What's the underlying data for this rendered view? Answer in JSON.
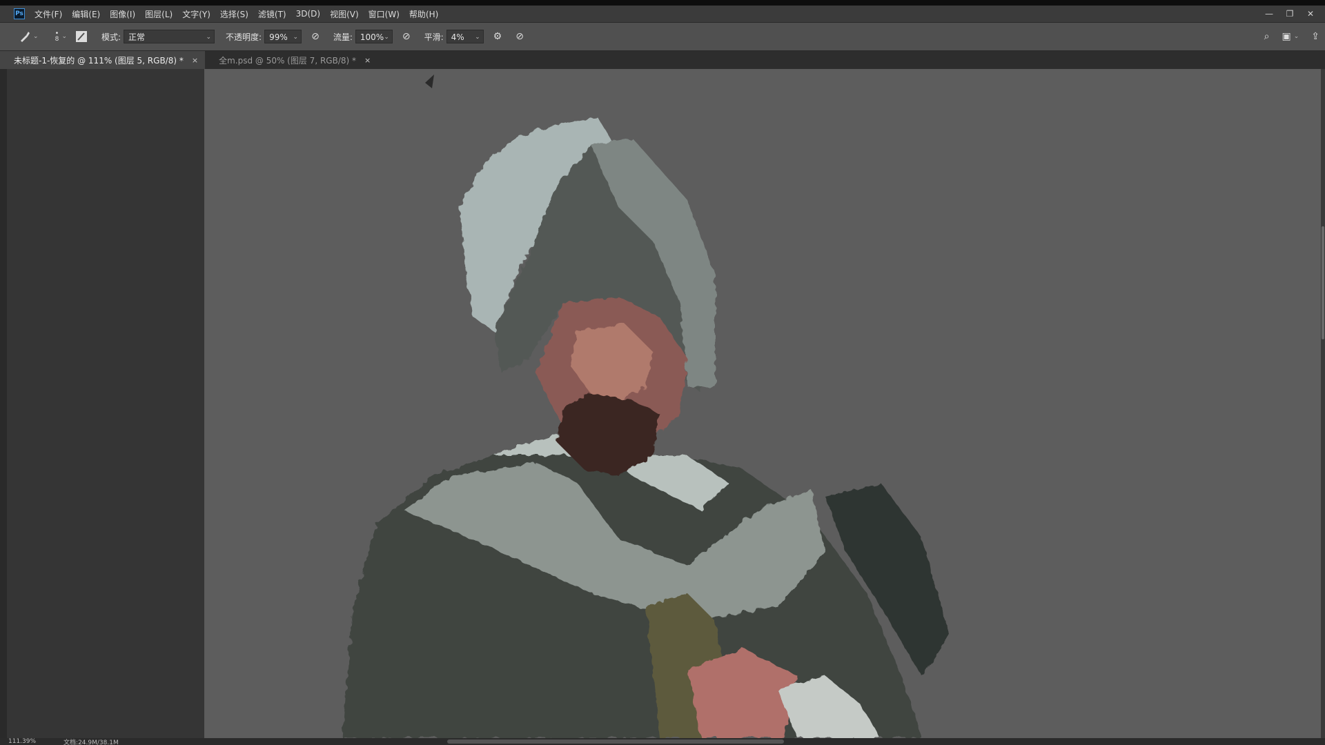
{
  "app": {
    "logo_text": "Ps",
    "menus": [
      "文件(F)",
      "编辑(E)",
      "图像(I)",
      "图层(L)",
      "文字(Y)",
      "选择(S)",
      "滤镜(T)",
      "3D(D)",
      "视图(V)",
      "窗口(W)",
      "帮助(H)"
    ],
    "window_controls": {
      "minimize": "—",
      "restore": "❐",
      "close": "✕"
    }
  },
  "options": {
    "tool_icon": "brush-icon",
    "brush_size": "8",
    "mode_label": "模式:",
    "mode_value": "正常",
    "opacity_label": "不透明度:",
    "opacity_value": "99%",
    "flow_label": "流量:",
    "flow_value": "100%",
    "smooth_label": "平滑:",
    "smooth_value": "4%"
  },
  "tabs": [
    {
      "label": "未标题-1-恢复的 @ 111% (图层 5, RGB/8) *",
      "close": "×"
    },
    {
      "label": "全m.psd @ 50% (图层 7, RGB/8) *",
      "close": "×"
    }
  ],
  "status": {
    "zoom": "111.39%",
    "doc": "文档:24.9M/38.1M"
  },
  "colors": {
    "accent_logo": "#54a8f0",
    "canvas_bg": "#5d5d5d",
    "panel_bg": "#353535"
  }
}
